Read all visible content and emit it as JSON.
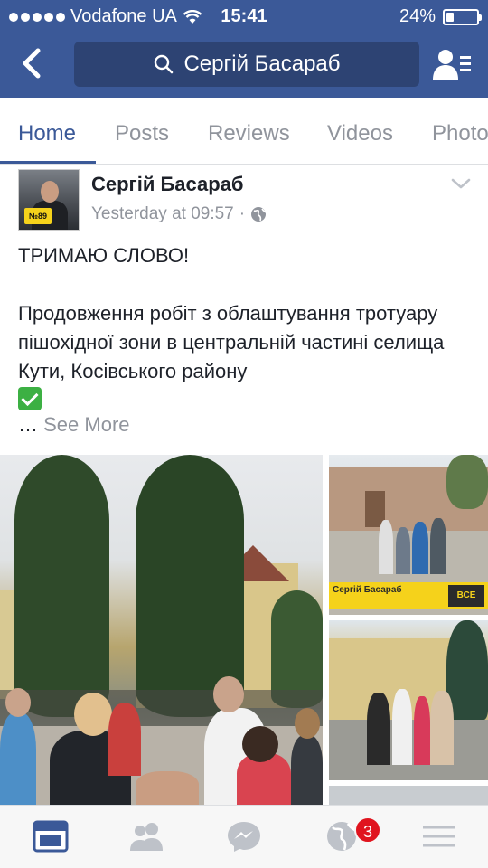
{
  "status_bar": {
    "carrier": "Vodafone UA",
    "time": "15:41",
    "battery": "24%",
    "battery_level": 0.24
  },
  "header": {
    "back_icon": "chevron-left-icon",
    "search_text": "Сергій Басараб",
    "search_icon": "search-icon",
    "friend_icon": "friend-requests-icon",
    "colors": {
      "brand": "#3b5998",
      "search_bg": "#2d4373"
    }
  },
  "tabs": [
    {
      "label": "Home",
      "active": true
    },
    {
      "label": "Posts",
      "active": false
    },
    {
      "label": "Reviews",
      "active": false
    },
    {
      "label": "Videos",
      "active": false
    },
    {
      "label": "Photo",
      "active": false
    }
  ],
  "post": {
    "author": "Сергій Басараб",
    "avatar_tag": "№89",
    "timestamp": "Yesterday at 09:57",
    "privacy_icon": "globe-icon",
    "menu_icon": "chevron-down-icon",
    "text_line1": "ТРИМАЮ СЛОВО!",
    "text_para": "Продовження робіт з облаштування тротуару пішохідної зони в центральній частині селища Кути, Косівського району",
    "emoji": "check-mark-button-icon",
    "ellipsis": "…",
    "see_more": "See More",
    "banner_text": "Сергій Басараб",
    "banner_box": "ВСЕ"
  },
  "bottom_nav": {
    "items": [
      {
        "icon": "news-feed-icon",
        "active": true
      },
      {
        "icon": "friends-icon",
        "active": false
      },
      {
        "icon": "messenger-icon",
        "active": false
      },
      {
        "icon": "notifications-globe-icon",
        "active": false,
        "badge": "3"
      },
      {
        "icon": "menu-icon",
        "active": false
      }
    ]
  }
}
